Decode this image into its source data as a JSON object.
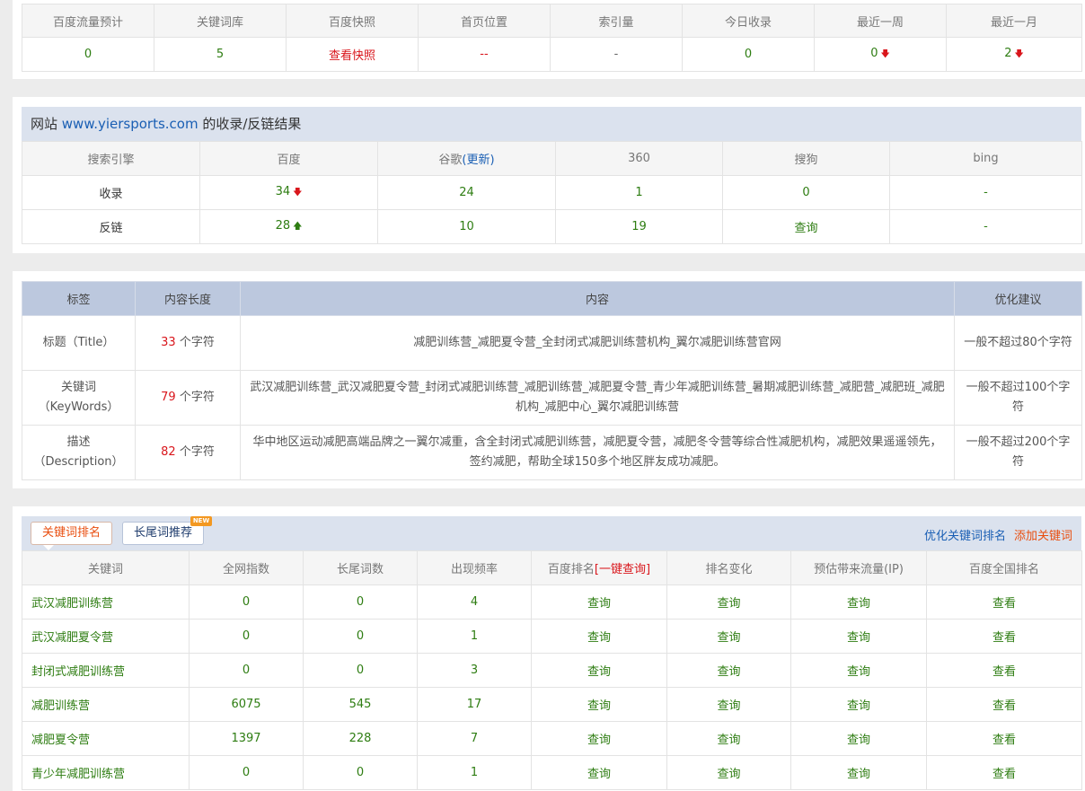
{
  "summary": {
    "headers": [
      "百度流量预计",
      "关键词库",
      "百度快照",
      "首页位置",
      "索引量",
      "今日收录",
      "最近一周",
      "最近一月"
    ],
    "values": {
      "traffic": "0",
      "keywords": "5",
      "snapshot": "查看快照",
      "home_position": "--",
      "index": "-",
      "today": "0",
      "week": "0",
      "month": "2"
    },
    "week_trend": "down",
    "month_trend": "down"
  },
  "indexing": {
    "title_prefix": "网站 ",
    "domain": "www.yiersports.com",
    "title_suffix": " 的收录/反链结果",
    "headers": {
      "engine": "搜索引擎",
      "baidu": "百度",
      "google": "谷歌",
      "google_update": "(更新)",
      "s360": "360",
      "sogou": "搜狗",
      "bing": "bing"
    },
    "rows": [
      {
        "label": "收录",
        "baidu": "34",
        "baidu_trend": "down",
        "google": "24",
        "s360": "1",
        "sogou": "0",
        "bing": "-"
      },
      {
        "label": "反链",
        "baidu": "28",
        "baidu_trend": "up",
        "google": "10",
        "s360": "19",
        "sogou": "查询",
        "bing": "-"
      }
    ]
  },
  "meta": {
    "headers": [
      "标签",
      "内容长度",
      "内容",
      "优化建议"
    ],
    "unit": "个字符",
    "rows": [
      {
        "label_1": "标题（Title）",
        "label_2": "",
        "length": "33",
        "content": "减肥训练营_减肥夏令营_全封闭式减肥训练营机构_翼尔减肥训练营官网",
        "advice": "一般不超过80个字符"
      },
      {
        "label_1": "关键词",
        "label_2": "（KeyWords）",
        "length": "79",
        "content": "武汉减肥训练营_武汉减肥夏令营_封闭式减肥训练营_减肥训练营_减肥夏令营_青少年减肥训练营_暑期减肥训练营_减肥营_减肥班_减肥机构_减肥中心_翼尔减肥训练营",
        "advice": "一般不超过100个字符"
      },
      {
        "label_1": "描述",
        "label_2": "（Description）",
        "length": "82",
        "content": "华中地区运动减肥高端品牌之一翼尔减重，含全封闭式减肥训练营，减肥夏令营，减肥冬令营等综合性减肥机构，减肥效果遥遥领先，签约减肥，帮助全球150多个地区胖友成功减肥。",
        "advice": "一般不超过200个字符"
      }
    ]
  },
  "keyword_panel": {
    "tab_rank": "关键词排名",
    "tab_long": "长尾词推荐",
    "new_badge": "NEW",
    "link_optimize": "优化关键词排名",
    "link_add": "添加关键词",
    "headers": {
      "keyword": "关键词",
      "index": "全网指数",
      "longtail": "长尾词数",
      "frequency": "出现频率",
      "baidu_rank": "百度排名",
      "baidu_rank_link": "[一键查询]",
      "change": "排名变化",
      "traffic": "预估带来流量(IP)",
      "national": "百度全国排名"
    },
    "rows": [
      {
        "keyword": "武汉减肥训练营",
        "index": "0",
        "longtail": "0",
        "frequency": "4",
        "rank": "查询",
        "change": "查询",
        "traffic": "查询",
        "national": "查看"
      },
      {
        "keyword": "武汉减肥夏令营",
        "index": "0",
        "longtail": "0",
        "frequency": "1",
        "rank": "查询",
        "change": "查询",
        "traffic": "查询",
        "national": "查看"
      },
      {
        "keyword": "封闭式减肥训练营",
        "index": "0",
        "longtail": "0",
        "frequency": "3",
        "rank": "查询",
        "change": "查询",
        "traffic": "查询",
        "national": "查看"
      },
      {
        "keyword": "减肥训练营",
        "index": "6075",
        "longtail": "545",
        "frequency": "17",
        "rank": "查询",
        "change": "查询",
        "traffic": "查询",
        "national": "查看"
      },
      {
        "keyword": "减肥夏令营",
        "index": "1397",
        "longtail": "228",
        "frequency": "7",
        "rank": "查询",
        "change": "查询",
        "traffic": "查询",
        "national": "查看"
      },
      {
        "keyword": "青少年减肥训练营",
        "index": "0",
        "longtail": "0",
        "frequency": "1",
        "rank": "查询",
        "change": "查询",
        "traffic": "查询",
        "national": "查看"
      }
    ]
  },
  "colors": {
    "green": "#2e7d12",
    "red": "#d9161c",
    "blue": "#1a5fb4",
    "orange": "#e94e0f",
    "header_blue": "#dbe2ee",
    "meta_header": "#bcc8de"
  },
  "icons": {
    "down": "arrow-down-icon",
    "up": "arrow-up-icon"
  }
}
